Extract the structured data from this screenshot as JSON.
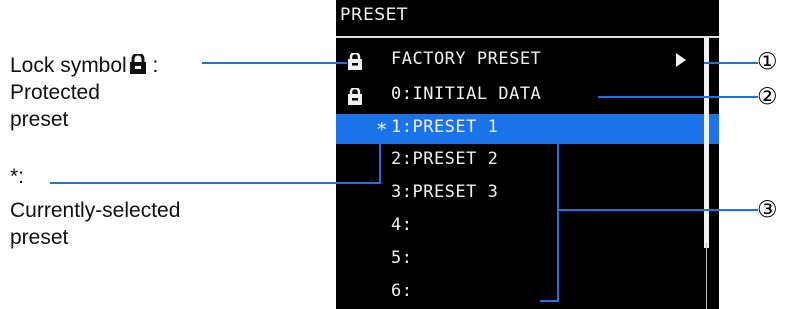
{
  "annotations": {
    "lock_line1": "Lock symbol",
    "lock_colon": " :",
    "lock_line2": "Protected",
    "lock_line3": "preset",
    "star_line1": "*:",
    "star_line2": "Currently-selected",
    "star_line3": "preset"
  },
  "screen": {
    "title": "PRESET",
    "rows": [
      {
        "label": "FACTORY PRESET",
        "locked": true,
        "marker": "",
        "has_arrow": true,
        "selected": false
      },
      {
        "label": "0:INITIAL DATA",
        "locked": true,
        "marker": "",
        "has_arrow": false,
        "selected": false
      },
      {
        "label": "1:PRESET 1",
        "locked": false,
        "marker": "*",
        "has_arrow": false,
        "selected": true
      },
      {
        "label": "2:PRESET 2",
        "locked": false,
        "marker": "",
        "has_arrow": false,
        "selected": false
      },
      {
        "label": "3:PRESET 3",
        "locked": false,
        "marker": "",
        "has_arrow": false,
        "selected": false
      },
      {
        "label": "4:",
        "locked": false,
        "marker": "",
        "has_arrow": false,
        "selected": false
      },
      {
        "label": "5:",
        "locked": false,
        "marker": "",
        "has_arrow": false,
        "selected": false
      },
      {
        "label": "6:",
        "locked": false,
        "marker": "",
        "has_arrow": false,
        "selected": false
      }
    ]
  },
  "callouts": [
    "①",
    "②",
    "③"
  ],
  "colors": {
    "screen_bg": "#000000",
    "selection": "#1a73e8",
    "text": "#f0f0f0"
  }
}
